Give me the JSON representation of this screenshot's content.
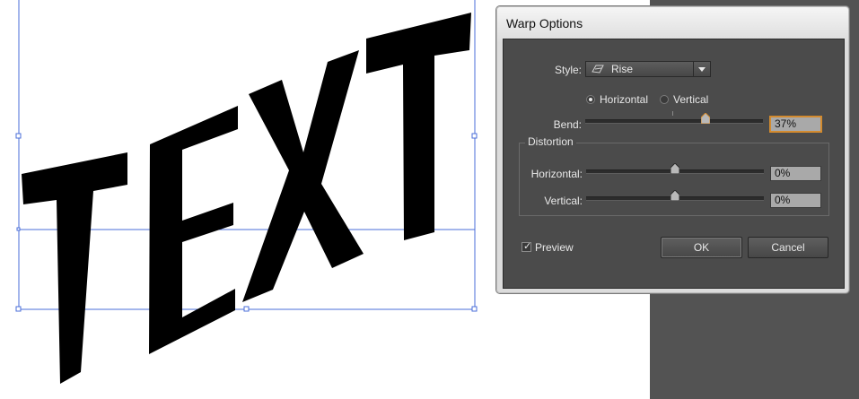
{
  "dialog": {
    "title": "Warp Options",
    "style": {
      "label": "Style:",
      "selected": "Rise",
      "icon": "rise-style-icon"
    },
    "orientation": {
      "horizontal_label": "Horizontal",
      "vertical_label": "Vertical",
      "selected": "horizontal"
    },
    "bend": {
      "label": "Bend:",
      "value": "37%",
      "percent": 37
    },
    "distortion": {
      "title": "Distortion",
      "horizontal": {
        "label": "Horizontal:",
        "value": "0%",
        "percent": 0
      },
      "vertical": {
        "label": "Vertical:",
        "value": "0%",
        "percent": 0
      }
    },
    "preview": {
      "label": "Preview",
      "checked": true
    },
    "ok_label": "OK",
    "cancel_label": "Cancel"
  },
  "artwork": {
    "text": "TEXT",
    "fill_color": "#000000",
    "selection_color": "#4a6ed8"
  },
  "colors": {
    "dialog_body": "#4b4b4b",
    "panel_background": "#535353",
    "focus_accent": "#d38b2f"
  }
}
